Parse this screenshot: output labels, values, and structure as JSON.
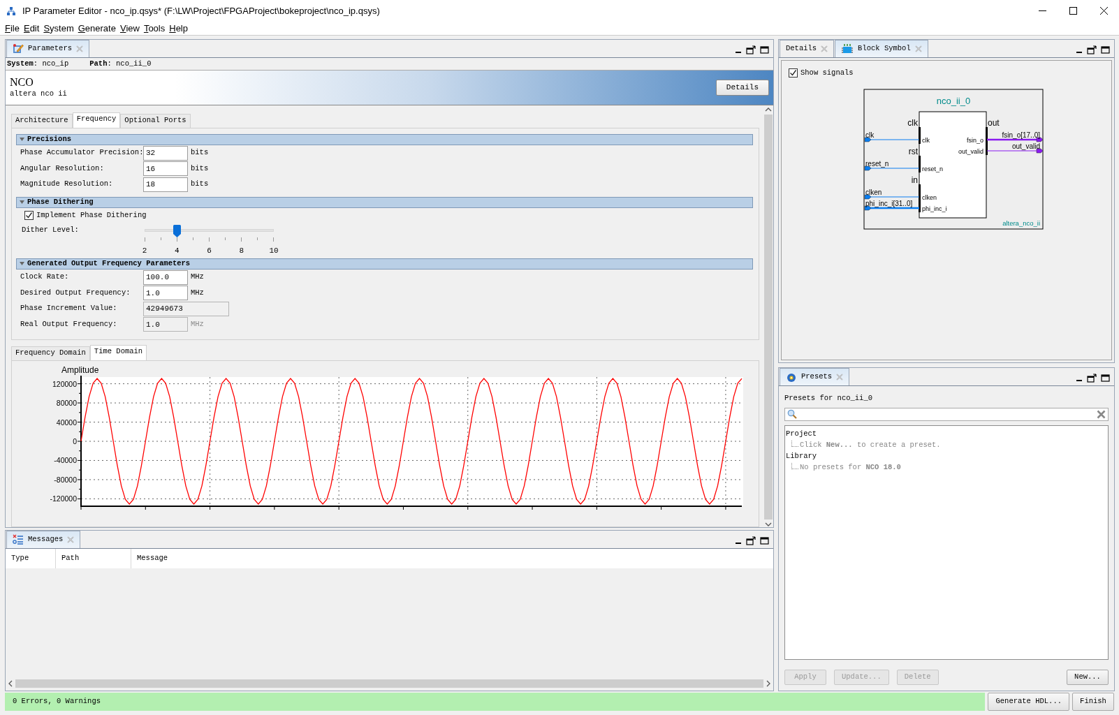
{
  "window": {
    "title": "IP Parameter Editor - nco_ip.qsys* (F:\\LW\\Project\\FPGAProject\\bokeproject\\nco_ip.qsys)"
  },
  "menu": [
    "File",
    "Edit",
    "System",
    "Generate",
    "View",
    "Tools",
    "Help"
  ],
  "parameters_panel": {
    "tab": "Parameters",
    "context": [
      "**System**: nco_ip",
      "**Path**: nco_ii_0"
    ],
    "component": {
      "title": "NCO",
      "subtitle": "altera nco ii"
    },
    "details_button": "Details",
    "tabs": [
      {
        "label": "Architecture",
        "selected": false
      },
      {
        "label": "Frequency",
        "selected": true
      },
      {
        "label": "Optional Ports",
        "selected": false
      }
    ],
    "sections": [
      {
        "title": "Precisions",
        "expanded": true,
        "rows": [
          {
            "kind": "field",
            "label": "Phase Accumulator Precision:",
            "value": "32",
            "unit": "bits",
            "disabled": false
          },
          {
            "kind": "field",
            "label": "Angular Resolution:",
            "value": "16",
            "unit": "bits",
            "disabled": false
          },
          {
            "kind": "field",
            "label": "Magnitude Resolution:",
            "value": "18",
            "unit": "bits",
            "disabled": false
          }
        ]
      },
      {
        "title": "Phase Dithering",
        "expanded": true,
        "rows": [
          {
            "kind": "checkbox",
            "label": "Implement Phase Dithering",
            "checked": true
          },
          {
            "kind": "slider",
            "label": "Dither Level:",
            "level": 0.25,
            "ticks": [
              "2",
              "4",
              "6",
              "8",
              "10"
            ]
          }
        ]
      },
      {
        "title": "Generated Output Frequency Parameters",
        "expanded": true,
        "rows": [
          {
            "kind": "field",
            "label": "Clock Rate:",
            "value": "100.0",
            "unit": "MHz",
            "disabled": false
          },
          {
            "kind": "field",
            "label": "Desired Output Frequency:",
            "value": "1.0",
            "unit": "MHz",
            "disabled": false
          },
          {
            "kind": "field",
            "label": "Phase Increment Value:",
            "value": "42949673",
            "disabled": true
          },
          {
            "kind": "field",
            "label": "Real Output Frequency:",
            "value": "1.0",
            "unit": "MHz",
            "disabled": true
          }
        ]
      }
    ],
    "plot_tabs": [
      {
        "label": "Frequency Domain",
        "selected": false
      },
      {
        "label": "Time Domain",
        "selected": true
      }
    ],
    "chart_data": {
      "type": "line",
      "ylabel": "Amplitude",
      "categories": [
        null,
        null,
        null,
        null,
        null,
        null,
        null,
        null,
        null,
        null,
        null,
        null,
        null,
        null,
        null,
        null,
        null,
        null,
        null,
        null,
        null,
        null,
        null,
        null,
        null,
        null,
        null,
        null,
        null,
        null,
        null,
        null,
        null,
        null,
        null,
        null,
        null,
        null,
        null,
        null,
        null,
        null,
        null,
        null,
        null,
        null,
        null,
        null,
        null,
        null,
        null,
        null,
        null,
        null,
        null,
        null,
        null,
        null,
        null,
        null,
        null,
        null,
        null,
        null,
        null,
        null,
        null,
        null,
        null,
        null,
        null,
        null,
        null,
        null,
        null,
        null,
        null,
        null,
        null,
        null,
        null,
        null,
        null,
        null,
        null,
        null,
        null,
        null,
        null,
        null,
        null,
        null,
        null,
        null,
        null,
        null,
        null,
        null,
        null,
        null,
        null,
        null,
        null,
        null,
        null,
        null,
        null,
        null,
        null,
        null,
        null,
        null,
        null,
        null,
        null,
        null,
        null,
        null,
        null,
        null,
        null,
        null,
        null,
        null,
        null,
        null,
        null,
        null,
        null,
        null,
        null,
        null,
        null,
        null,
        null,
        null,
        null,
        null,
        null,
        null,
        null,
        null,
        null,
        null,
        null,
        null,
        null,
        null,
        null,
        null,
        null,
        null,
        null,
        null,
        null,
        null,
        null,
        null,
        null,
        null,
        null,
        null,
        null,
        null,
        null
      ],
      "series": [
        {
          "color": "#ff0000",
          "values": [
            0,
            50000,
            93000,
            121000,
            131000,
            121000,
            93000,
            50000,
            0,
            -50000,
            -93000,
            -121000,
            -131000,
            -121000,
            -93000,
            -50000,
            0,
            50000,
            93000,
            121000,
            131000,
            121000,
            93000,
            50000,
            0,
            -50000,
            -93000,
            -121000,
            -131000,
            -121000,
            -93000,
            -50000,
            0,
            50000,
            93000,
            121000,
            131000,
            121000,
            93000,
            50000,
            0,
            -50000,
            -93000,
            -121000,
            -131000,
            -121000,
            -93000,
            -50000,
            0,
            50000,
            93000,
            121000,
            131000,
            121000,
            93000,
            50000,
            0,
            -50000,
            -93000,
            -121000,
            -131000,
            -121000,
            -93000,
            -50000,
            0,
            50000,
            93000,
            121000,
            131000,
            121000,
            93000,
            50000,
            0,
            -50000,
            -93000,
            -121000,
            -131000,
            -121000,
            -93000,
            -50000,
            0,
            50000,
            93000,
            121000,
            131000,
            121000,
            93000,
            50000,
            0,
            -50000,
            -93000,
            -121000,
            -131000,
            -121000,
            -93000,
            -50000,
            0,
            50000,
            93000,
            121000,
            131000,
            121000,
            93000,
            50000,
            0,
            -50000,
            -93000,
            -121000,
            -131000,
            -121000,
            -93000,
            -50000,
            0,
            50000,
            93000,
            121000,
            131000,
            121000,
            93000,
            50000,
            0,
            -50000,
            -93000,
            -121000,
            -131000,
            -121000,
            -93000,
            -50000,
            0,
            50000,
            93000,
            121000,
            131000,
            121000,
            93000,
            50000,
            0,
            -50000,
            -93000,
            -121000,
            -131000,
            -121000,
            -93000,
            -50000,
            0,
            50000,
            93000,
            121000,
            131000,
            121000,
            93000,
            50000,
            0,
            -50000,
            -93000,
            -121000,
            -131000,
            -121000,
            -93000,
            -50000,
            0,
            50000,
            93000,
            121000,
            131000
          ]
        }
      ],
      "ylim": [
        -131072,
        131072
      ],
      "grid": true,
      "yticks": [
        -120000,
        -80000,
        -40000,
        0,
        40000,
        80000,
        120000
      ]
    }
  },
  "messages_panel": {
    "tab": "Messages",
    "columns": [
      "Type",
      "Path",
      "Message"
    ]
  },
  "block_symbol_panel": {
    "tabs": [
      {
        "label": "Details",
        "selected": false
      },
      {
        "label": "Block Symbol",
        "selected": true
      }
    ],
    "show_signals": {
      "label": "Show signals",
      "checked": true
    },
    "symbol": {
      "instance": "nco_ii_0",
      "module": "altera_nco_ii",
      "inputs": [
        {
          "interface": "clk",
          "ports": [
            {
              "signal": "clk",
              "port": "clk",
              "bus": false
            }
          ]
        },
        {
          "interface": "rst",
          "ports": [
            {
              "signal": "reset_n",
              "port": "reset_n",
              "bus": false
            }
          ]
        },
        {
          "interface": "in",
          "ports": [
            {
              "signal": "clken",
              "port": "clken",
              "bus": false
            },
            {
              "signal": "phi_inc_i[31..0]",
              "port": "phi_inc_i",
              "bus": true
            }
          ]
        }
      ],
      "outputs": [
        {
          "interface": "out",
          "ports": [
            {
              "signal": "fsin_o[17..0]",
              "port": "fsin_o",
              "bus": true
            },
            {
              "signal": "out_valid",
              "port": "out_valid",
              "bus": false
            }
          ]
        }
      ]
    }
  },
  "presets_panel": {
    "tab": "Presets",
    "heading": "Presets for nco_ii_0",
    "tree": [
      {
        "label": "Project",
        "children": [
          {
            "label": "Click **New...** to create a preset."
          }
        ]
      },
      {
        "label": "Library",
        "children": [
          {
            "label": "No presets for **NCO 18.0**"
          }
        ]
      }
    ],
    "buttons": [
      {
        "label": "Apply",
        "disabled": true
      },
      {
        "label": "Update...",
        "disabled": true
      },
      {
        "label": "Delete",
        "disabled": true
      },
      {
        "label": "New...",
        "disabled": false
      }
    ]
  },
  "status_bar": {
    "message": "0 Errors, 0 Warnings",
    "buttons": [
      "Generate HDL...",
      "Finish"
    ]
  }
}
